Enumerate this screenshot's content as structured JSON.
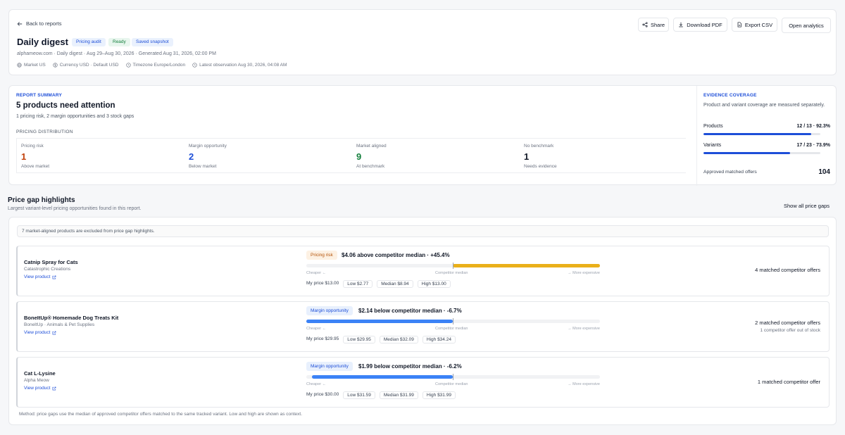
{
  "header": {
    "back_label": "Back to reports",
    "title": "Daily digest",
    "chips": [
      "Pricing audit",
      "Ready",
      "Saved snapshot"
    ],
    "subline": "alphameow.com · Daily digest · Aug 29–Aug 30, 2026 · Generated Aug 31, 2026, 02:00 PM",
    "meta": {
      "market": "Market US",
      "currency": "Currency USD · Default USD",
      "timezone": "Timezone Europe/London",
      "latest": "Latest observation Aug 30, 2026, 04:08 AM"
    },
    "actions": {
      "share": "Share",
      "download_pdf": "Download PDF",
      "export_csv": "Export CSV",
      "open_analytics": "Open analytics"
    }
  },
  "summary": {
    "kicker": "REPORT SUMMARY",
    "title": "5 products need attention",
    "subtitle": "1 pricing risk, 2 margin opportunities and 3 stock gaps",
    "dist_label": "PRICING DISTRIBUTION",
    "distribution": [
      {
        "label": "Pricing risk",
        "value": "1",
        "desc": "Above market",
        "color": "#c2410c"
      },
      {
        "label": "Margin opportunity",
        "value": "2",
        "desc": "Below market",
        "color": "#1d4ed8"
      },
      {
        "label": "Market aligned",
        "value": "9",
        "desc": "At benchmark",
        "color": "#15803d"
      },
      {
        "label": "No benchmark",
        "value": "1",
        "desc": "Needs evidence",
        "color": "#111827"
      }
    ]
  },
  "coverage": {
    "kicker": "EVIDENCE COVERAGE",
    "description": "Product and variant coverage are measured separately.",
    "products_label": "Products",
    "products_value": "12 / 13 · 92.3%",
    "products_pct": 92.3,
    "variants_label": "Variants",
    "variants_value": "17 / 23 · 73.9%",
    "variants_pct": 73.9,
    "approved_label": "Approved matched offers",
    "approved_value": "104",
    "accent": "#1d4ed8"
  },
  "gaps": {
    "title": "Price gap highlights",
    "subtitle": "Largest variant-level pricing opportunities found in this report.",
    "show_all": "Show all price gaps",
    "notice": "7 market-aligned products are excluded from price gap highlights.",
    "axis": {
      "left": "Cheaper ←",
      "mid": "Competitor median",
      "right": "→ More expensive"
    },
    "view_label": "View product",
    "rows": [
      {
        "name": "Catnip Spray for Cats",
        "brand": "Catastrophic Creations",
        "tag": "Pricing risk",
        "tag_kind": "risk",
        "headline": "$4.06 above competitor median · +45.4%",
        "gap_pct": 45.4,
        "prices": {
          "my": "My price $13.00",
          "low": "Low $2.77",
          "median": "Median $8.94",
          "high": "High $13.00"
        },
        "offers": "4 matched competitor offers",
        "offers_sub": "",
        "bar_color": "#eab01a"
      },
      {
        "name": "BoneItUp® Homemade Dog Treats Kit",
        "brand": "BoneItUp · Animals & Pet Supplies",
        "tag": "Margin opportunity",
        "tag_kind": "margin",
        "headline": "$2.14 below competitor median · -6.7%",
        "gap_pct": -6.7,
        "prices": {
          "my": "My price $29.95",
          "low": "Low $29.95",
          "median": "Median $32.09",
          "high": "High $34.24"
        },
        "offers": "2 matched competitor offers",
        "offers_sub": "1 competitor offer out of stock",
        "bar_color": "#3b82f6"
      },
      {
        "name": "Cat L-Lysine",
        "brand": "Alpha Meow",
        "tag": "Margin opportunity",
        "tag_kind": "margin",
        "headline": "$1.99 below competitor median · -6.2%",
        "gap_pct": -6.2,
        "prices": {
          "my": "My price $30.00",
          "low": "Low $31.59",
          "median": "Median $31.99",
          "high": "High $31.99"
        },
        "offers": "1 matched competitor offer",
        "offers_sub": "",
        "bar_color": "#3b82f6"
      }
    ],
    "method": "Method: price gaps use the median of approved competitor offers matched to the same tracked variant. Low and high are shown as context."
  }
}
